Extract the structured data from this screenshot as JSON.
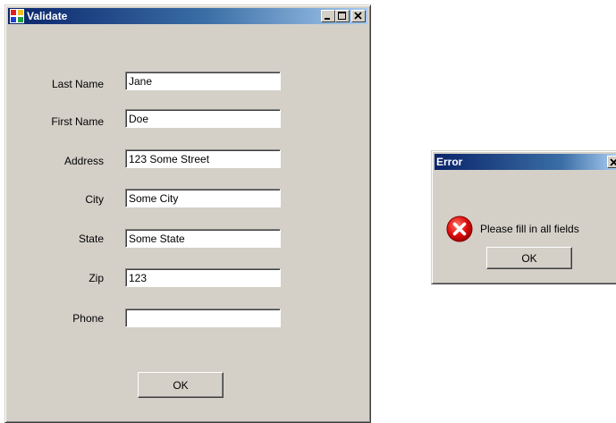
{
  "main_window": {
    "title": "Validate",
    "fields": [
      {
        "label": "Last Name",
        "value": "Jane"
      },
      {
        "label": "First Name",
        "value": "Doe"
      },
      {
        "label": "Address",
        "value": "123 Some Street"
      },
      {
        "label": "City",
        "value": "Some City"
      },
      {
        "label": "State",
        "value": "Some State"
      },
      {
        "label": "Zip",
        "value": "123"
      },
      {
        "label": "Phone",
        "value": ""
      }
    ],
    "ok_label": "OK"
  },
  "error_dialog": {
    "title": "Error",
    "message": "Please fill in all fields",
    "ok_label": "OK",
    "icon": "error-icon"
  },
  "colors": {
    "face": "#d4d0c8",
    "titlebar_start": "#0a246a",
    "titlebar_end": "#a6caf0",
    "error_red": "#e01010"
  }
}
